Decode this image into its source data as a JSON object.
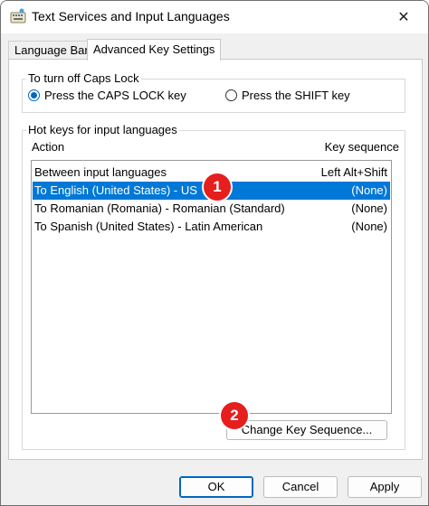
{
  "window": {
    "title": "Text Services and Input Languages",
    "close_glyph": "✕"
  },
  "tabs": [
    {
      "label": "Language Bar",
      "active": false
    },
    {
      "label": "Advanced Key Settings",
      "active": true
    }
  ],
  "caps_lock": {
    "group_label": "To turn off Caps Lock",
    "options": [
      {
        "label": "Press the CAPS LOCK key",
        "selected": true
      },
      {
        "label": "Press the SHIFT key",
        "selected": false
      }
    ]
  },
  "hotkeys": {
    "group_label": "Hot keys for input languages",
    "columns": {
      "action": "Action",
      "key_sequence": "Key sequence"
    },
    "rows": [
      {
        "action": "Between input languages",
        "key": "Left Alt+Shift",
        "selected": false
      },
      {
        "action": "To English (United States) - US",
        "key": "(None)",
        "selected": true
      },
      {
        "action": "To Romanian (Romania) - Romanian (Standard)",
        "key": "(None)",
        "selected": false
      },
      {
        "action": "To Spanish (United States) - Latin American",
        "key": "(None)",
        "selected": false
      }
    ],
    "change_button": "Change Key Sequence..."
  },
  "annotations": [
    {
      "label": "1",
      "color": "#e61e1e"
    },
    {
      "label": "2",
      "color": "#e61e1e"
    }
  ],
  "footer": {
    "ok": "OK",
    "cancel": "Cancel",
    "apply": "Apply"
  },
  "colors": {
    "accent": "#0067c0",
    "selection": "#0078d7",
    "annotation": "#e61e1e"
  }
}
